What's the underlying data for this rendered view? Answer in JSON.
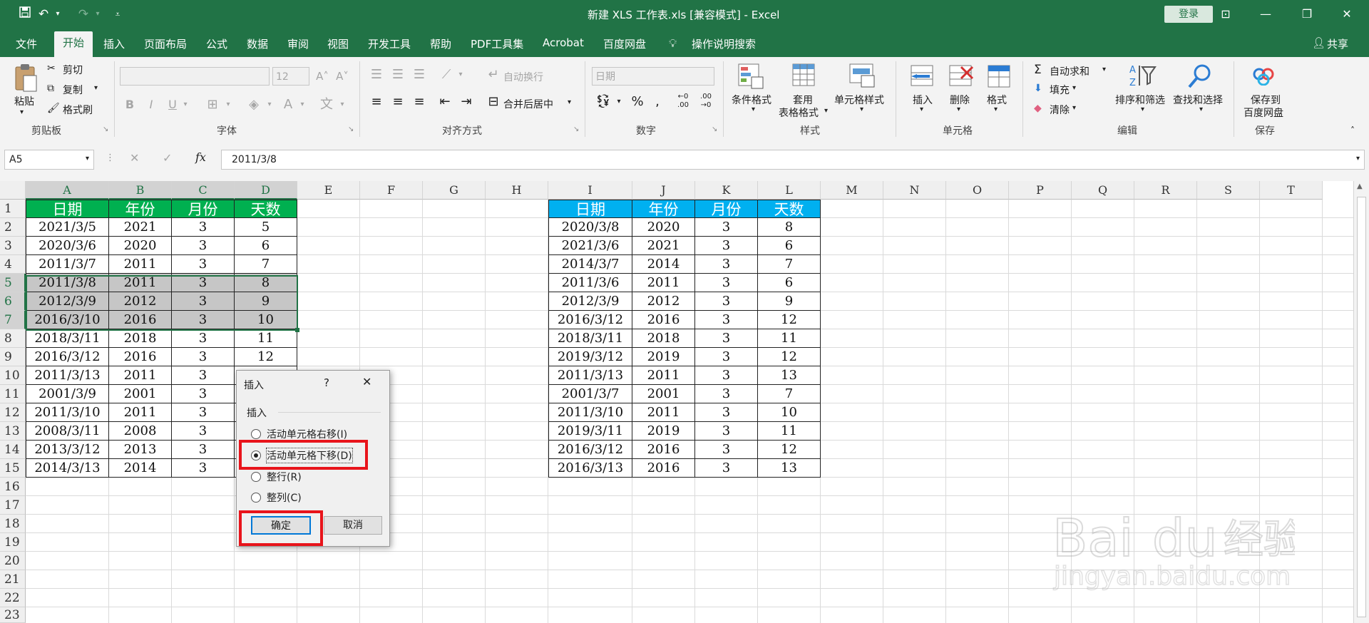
{
  "titlebar": {
    "title": "新建 XLS 工作表.xls  [兼容模式]  -  Excel",
    "login": "登录",
    "qat_icons": [
      "save-icon",
      "undo-icon",
      "redo-icon",
      "customize-icon"
    ]
  },
  "tabs": [
    "文件",
    "开始",
    "插入",
    "页面布局",
    "公式",
    "数据",
    "审阅",
    "视图",
    "开发工具",
    "帮助",
    "PDF工具集",
    "Acrobat",
    "百度网盘"
  ],
  "active_tab": "开始",
  "tellme": "操作说明搜索",
  "share": "共享",
  "ribbon": {
    "clipboard": {
      "paste": "粘贴",
      "cut": "剪切",
      "copy": "复制",
      "format_painter": "格式刷",
      "group": "剪贴板"
    },
    "font": {
      "font_name": "",
      "font_size": "12",
      "group": "字体"
    },
    "alignment": {
      "wrap": "自动换行",
      "merge": "合并后居中",
      "group": "对齐方式"
    },
    "number": {
      "format": "日期",
      "group": "数字"
    },
    "styles": {
      "conditional": "条件格式",
      "table_line1": "套用",
      "table_line2": "表格格式",
      "cell_styles": "单元格样式",
      "group": "样式"
    },
    "cells": {
      "insert": "插入",
      "delete": "删除",
      "format": "格式",
      "group": "单元格"
    },
    "editing": {
      "autosum": "自动求和",
      "fill": "填充",
      "clear": "清除",
      "sort": "排序和筛选",
      "find": "查找和选择",
      "group": "编辑"
    },
    "save": {
      "line1": "保存到",
      "line2": "百度网盘",
      "group": "保存"
    }
  },
  "formula_bar": {
    "name_box": "A5",
    "fx": "fx",
    "value": "2011/3/8"
  },
  "columns": [
    "A",
    "B",
    "C",
    "D",
    "E",
    "F",
    "G",
    "H",
    "I",
    "J",
    "K",
    "L",
    "M",
    "N",
    "O",
    "P",
    "Q",
    "R",
    "S",
    "T"
  ],
  "rows": [
    "1",
    "2",
    "3",
    "4",
    "5",
    "6",
    "7",
    "8",
    "9",
    "10",
    "11",
    "12",
    "13",
    "14",
    "15",
    "16",
    "17",
    "18",
    "19",
    "20",
    "21",
    "22",
    "23"
  ],
  "left_table": {
    "headers": [
      "日期",
      "年份",
      "月份",
      "天数"
    ],
    "header_color": "#00b050",
    "rows": [
      [
        "2021/3/5",
        "2021",
        "3",
        "5"
      ],
      [
        "2020/3/6",
        "2020",
        "3",
        "6"
      ],
      [
        "2011/3/7",
        "2011",
        "3",
        "7"
      ],
      [
        "2011/3/8",
        "2011",
        "3",
        "8"
      ],
      [
        "2012/3/9",
        "2012",
        "3",
        "9"
      ],
      [
        "2016/3/10",
        "2016",
        "3",
        "10"
      ],
      [
        "2018/3/11",
        "2018",
        "3",
        "11"
      ],
      [
        "2016/3/12",
        "2016",
        "3",
        "12"
      ],
      [
        "2011/3/13",
        "2011",
        "3",
        ""
      ],
      [
        "2001/3/9",
        "2001",
        "3",
        ""
      ],
      [
        "2011/3/10",
        "2011",
        "3",
        ""
      ],
      [
        "2008/3/11",
        "2008",
        "3",
        ""
      ],
      [
        "2013/3/12",
        "2013",
        "3",
        ""
      ],
      [
        "2014/3/13",
        "2014",
        "3",
        ""
      ]
    ]
  },
  "right_table": {
    "headers": [
      "日期",
      "年份",
      "月份",
      "天数"
    ],
    "header_color": "#00b0f0",
    "rows": [
      [
        "2020/3/8",
        "2020",
        "3",
        "8"
      ],
      [
        "2021/3/6",
        "2021",
        "3",
        "6"
      ],
      [
        "2014/3/7",
        "2014",
        "3",
        "7"
      ],
      [
        "2011/3/6",
        "2011",
        "3",
        "6"
      ],
      [
        "2012/3/9",
        "2012",
        "3",
        "9"
      ],
      [
        "2016/3/12",
        "2016",
        "3",
        "12"
      ],
      [
        "2018/3/11",
        "2018",
        "3",
        "11"
      ],
      [
        "2019/3/12",
        "2019",
        "3",
        "12"
      ],
      [
        "2011/3/13",
        "2011",
        "3",
        "13"
      ],
      [
        "2001/3/7",
        "2001",
        "3",
        "7"
      ],
      [
        "2011/3/10",
        "2011",
        "3",
        "10"
      ],
      [
        "2019/3/11",
        "2019",
        "3",
        "11"
      ],
      [
        "2016/3/12",
        "2016",
        "3",
        "12"
      ],
      [
        "2016/3/13",
        "2016",
        "3",
        "13"
      ]
    ]
  },
  "dialog": {
    "title": "插入",
    "help": "?",
    "section": "插入",
    "options": [
      {
        "label": "活动单元格右移(I)",
        "checked": false
      },
      {
        "label": "活动单元格下移(D)",
        "checked": true
      },
      {
        "label": "整行(R)",
        "checked": false
      },
      {
        "label": "整列(C)",
        "checked": false
      }
    ],
    "ok": "确定",
    "cancel": "取消",
    "highlight_color": "#e8141b"
  }
}
